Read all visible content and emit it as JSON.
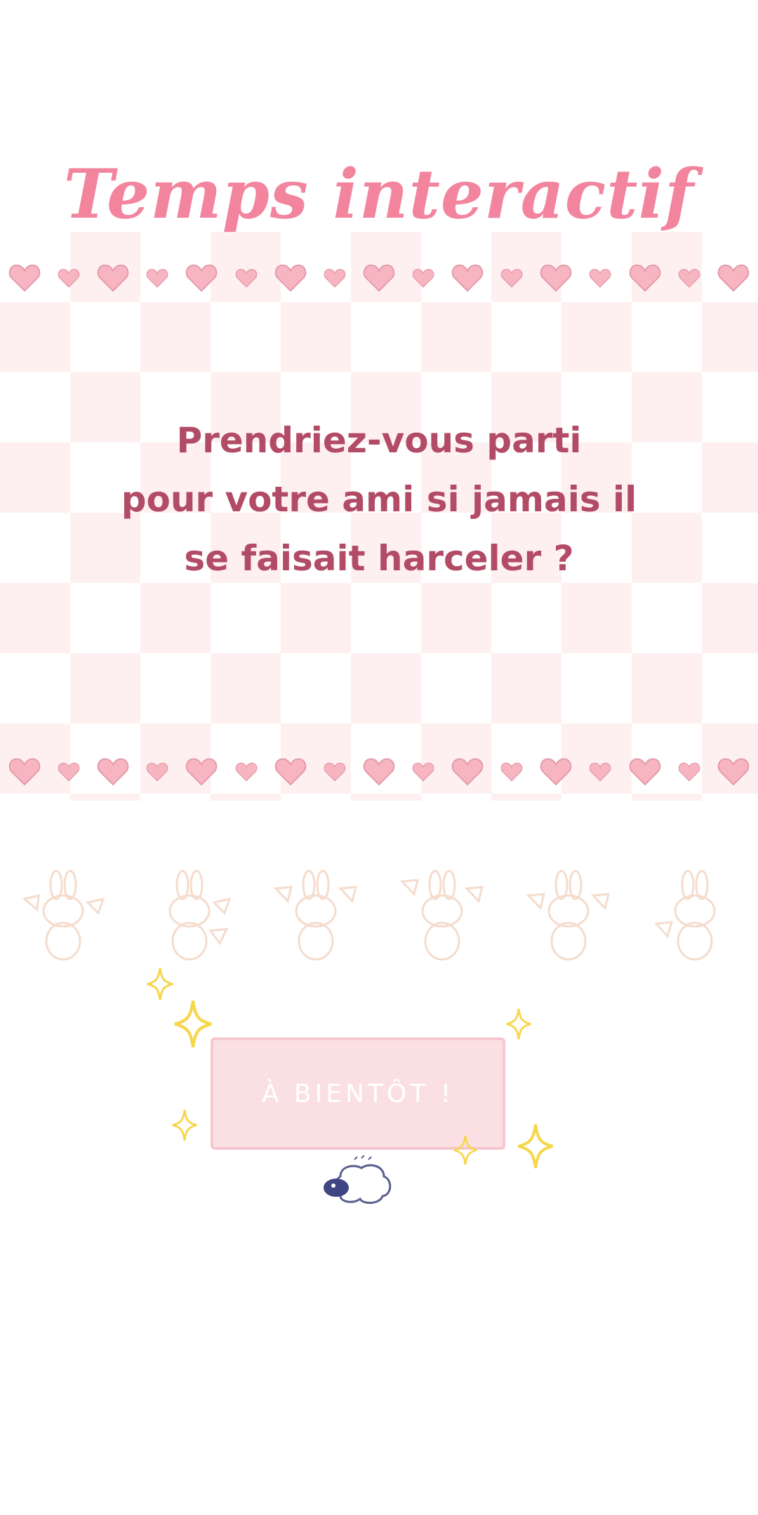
{
  "title": "Temps interactif",
  "question": {
    "line1": "Prendriez-vous parti",
    "line2": "pour votre ami si jamais il",
    "line3": "se faisait harceler ?"
  },
  "button": {
    "label": "À BIENTÔT !"
  },
  "colors": {
    "title": "#f2849e",
    "question": "#b24b66",
    "checker_pink": "#fde3e6",
    "heart": "#f7b5c1",
    "button_bg": "#fbe0e3",
    "sparkle": "#f7d64a"
  },
  "icons": {
    "hearts": "heart-icon",
    "bunnies": "bunny-icon",
    "sparkles": "sparkle-icon",
    "mascot": "sheep-icon"
  }
}
